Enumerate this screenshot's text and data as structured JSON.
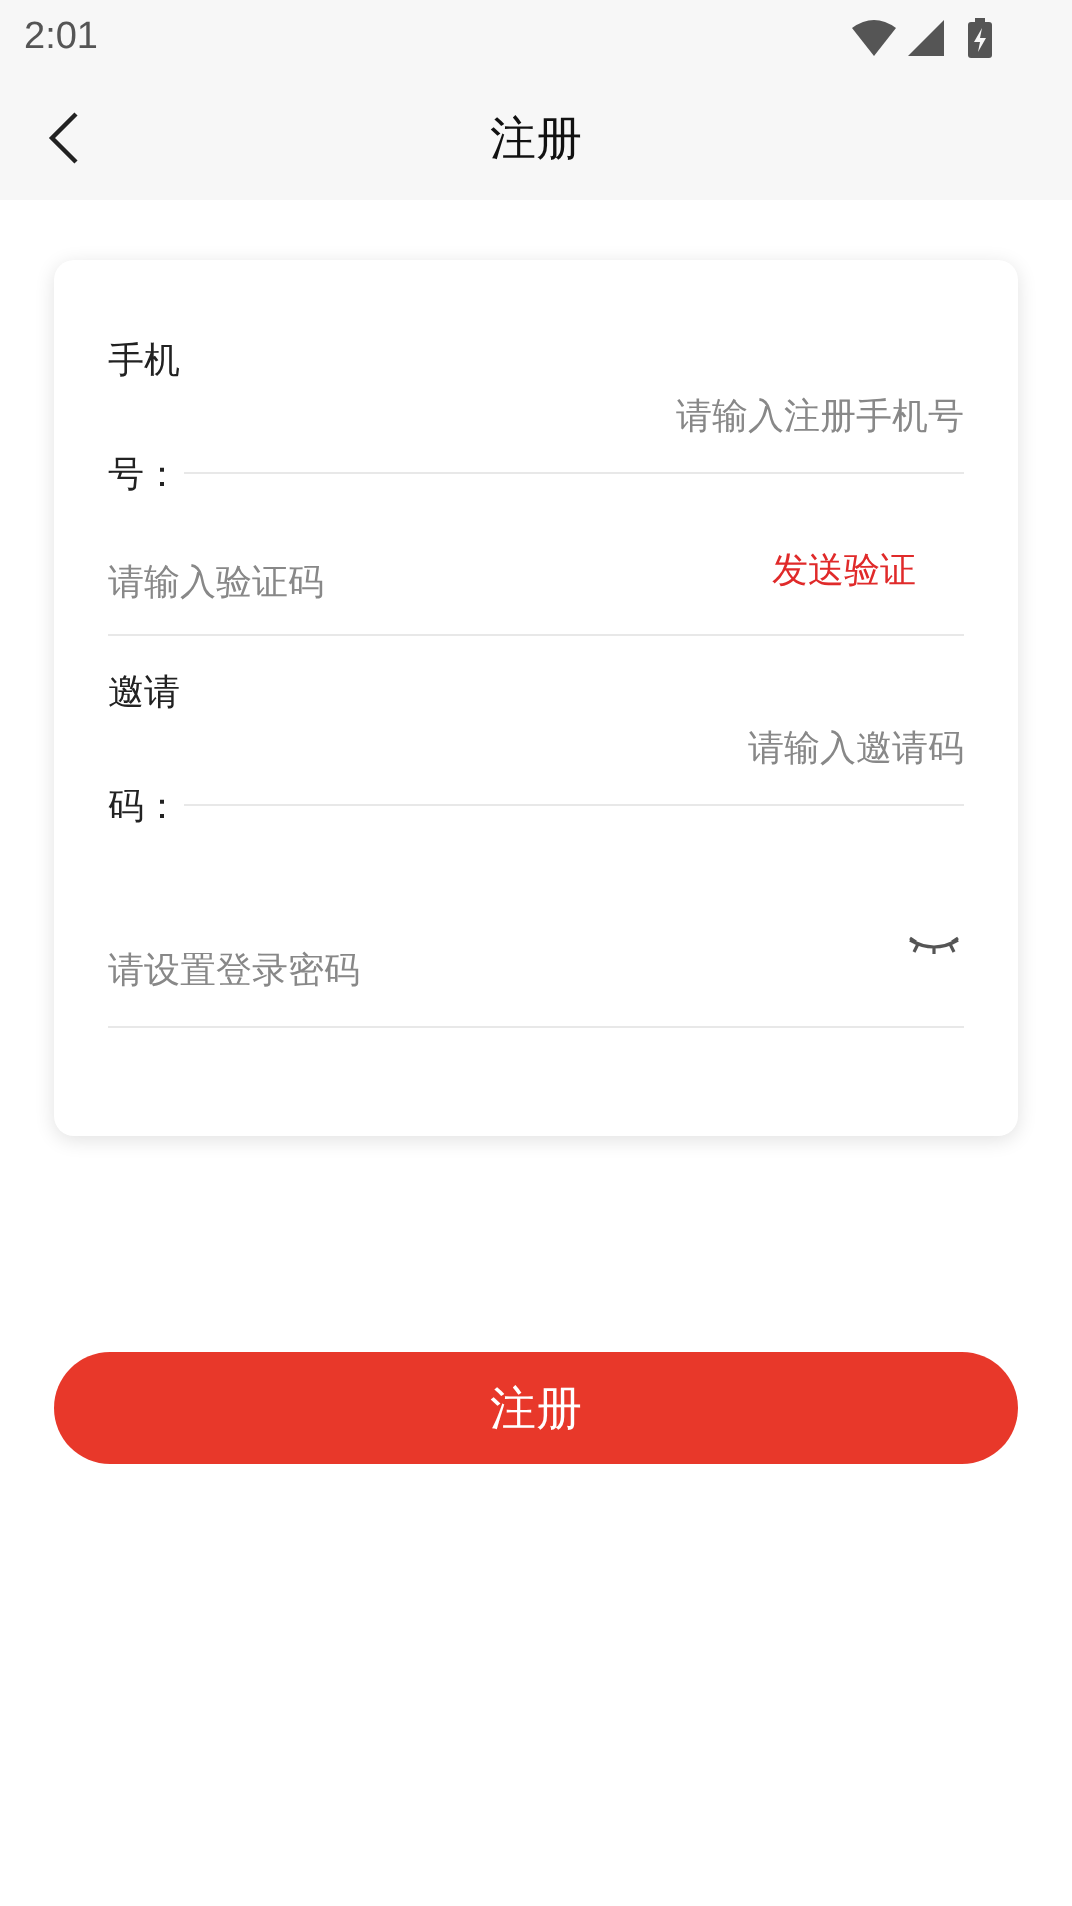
{
  "status_bar": {
    "time": "2:01"
  },
  "header": {
    "title": "注册"
  },
  "form": {
    "fields": [
      {
        "kind": "labeled",
        "label": "手机号：",
        "placeholder": "请输入注册手机号"
      },
      {
        "kind": "code",
        "placeholder": "请输入验证码",
        "action": "发送验证"
      },
      {
        "kind": "labeled",
        "label": "邀请码：",
        "placeholder": "请输入邀请码"
      },
      {
        "kind": "password",
        "placeholder": "请设置登录密码"
      }
    ]
  },
  "submit_button": {
    "label": "注册"
  }
}
